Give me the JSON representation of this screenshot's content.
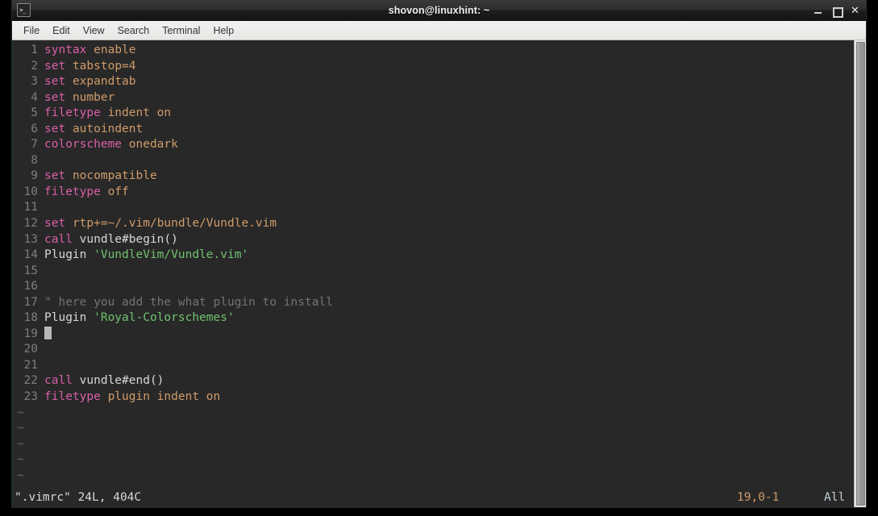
{
  "window": {
    "title": "shovon@linuxhint: ~",
    "icon": "terminal-icon",
    "controls": {
      "minimize": "–",
      "maximize": "□",
      "close": "✕"
    }
  },
  "menubar": {
    "items": [
      {
        "label": "File"
      },
      {
        "label": "Edit"
      },
      {
        "label": "View"
      },
      {
        "label": "Search"
      },
      {
        "label": "Terminal"
      },
      {
        "label": "Help"
      }
    ]
  },
  "editor": {
    "colors": {
      "background": "#282828",
      "keyword": "#d85fa8",
      "argument": "#cf9b6a",
      "identifier": "#d8d8d8",
      "string": "#71c171",
      "comment": "#6f7575",
      "line_number": "#7a7f7f",
      "tilde": "#5a6b6d",
      "cursor": "#b8b8b8"
    },
    "lines": [
      {
        "num": "1",
        "tokens": [
          {
            "t": "syntax",
            "c": "kw"
          },
          {
            "t": " ",
            "c": "id"
          },
          {
            "t": "enable",
            "c": "arg"
          }
        ]
      },
      {
        "num": "2",
        "tokens": [
          {
            "t": "set",
            "c": "kw"
          },
          {
            "t": " ",
            "c": "id"
          },
          {
            "t": "tabstop=4",
            "c": "arg"
          }
        ]
      },
      {
        "num": "3",
        "tokens": [
          {
            "t": "set",
            "c": "kw"
          },
          {
            "t": " ",
            "c": "id"
          },
          {
            "t": "expandtab",
            "c": "arg"
          }
        ]
      },
      {
        "num": "4",
        "tokens": [
          {
            "t": "set",
            "c": "kw"
          },
          {
            "t": " ",
            "c": "id"
          },
          {
            "t": "number",
            "c": "arg"
          }
        ]
      },
      {
        "num": "5",
        "tokens": [
          {
            "t": "filetype",
            "c": "kw"
          },
          {
            "t": " ",
            "c": "id"
          },
          {
            "t": "indent on",
            "c": "arg"
          }
        ]
      },
      {
        "num": "6",
        "tokens": [
          {
            "t": "set",
            "c": "kw"
          },
          {
            "t": " ",
            "c": "id"
          },
          {
            "t": "autoindent",
            "c": "arg"
          }
        ]
      },
      {
        "num": "7",
        "tokens": [
          {
            "t": "colorscheme",
            "c": "kw"
          },
          {
            "t": " ",
            "c": "id"
          },
          {
            "t": "onedark",
            "c": "arg"
          }
        ]
      },
      {
        "num": "8",
        "tokens": []
      },
      {
        "num": "9",
        "tokens": [
          {
            "t": "set",
            "c": "kw"
          },
          {
            "t": " ",
            "c": "id"
          },
          {
            "t": "nocompatible",
            "c": "arg"
          }
        ]
      },
      {
        "num": "10",
        "tokens": [
          {
            "t": "filetype",
            "c": "kw"
          },
          {
            "t": " ",
            "c": "id"
          },
          {
            "t": "off",
            "c": "arg"
          }
        ]
      },
      {
        "num": "11",
        "tokens": []
      },
      {
        "num": "12",
        "tokens": [
          {
            "t": "set",
            "c": "kw"
          },
          {
            "t": " ",
            "c": "id"
          },
          {
            "t": "rtp+=~/.vim/bundle/Vundle.vim",
            "c": "arg"
          }
        ]
      },
      {
        "num": "13",
        "tokens": [
          {
            "t": "call",
            "c": "kw"
          },
          {
            "t": " vundle#begin()",
            "c": "id"
          }
        ]
      },
      {
        "num": "14",
        "tokens": [
          {
            "t": "Plugin ",
            "c": "id"
          },
          {
            "t": "'VundleVim/Vundle.vim'",
            "c": "str"
          }
        ]
      },
      {
        "num": "15",
        "tokens": []
      },
      {
        "num": "16",
        "tokens": []
      },
      {
        "num": "17",
        "tokens": [
          {
            "t": "\" here you add the what plugin to install",
            "c": "cmt"
          }
        ]
      },
      {
        "num": "18",
        "tokens": [
          {
            "t": "Plugin ",
            "c": "id"
          },
          {
            "t": "'Royal-Colorschemes'",
            "c": "str"
          }
        ]
      },
      {
        "num": "19",
        "tokens": [
          {
            "t": "",
            "c": "cursor"
          }
        ]
      },
      {
        "num": "20",
        "tokens": []
      },
      {
        "num": "21",
        "tokens": []
      },
      {
        "num": "22",
        "tokens": [
          {
            "t": "call",
            "c": "kw"
          },
          {
            "t": " vundle#end()",
            "c": "id"
          }
        ]
      },
      {
        "num": "23",
        "tokens": [
          {
            "t": "filetype",
            "c": "kw"
          },
          {
            "t": " ",
            "c": "id"
          },
          {
            "t": "plugin indent on",
            "c": "arg"
          }
        ]
      }
    ],
    "empty_markers": [
      "~",
      "~",
      "~",
      "~",
      "~",
      "~",
      "~"
    ],
    "cursor_line": 19
  },
  "statusline": {
    "file_info": "\".vimrc\" 24L, 404C",
    "position": "19,0-1",
    "scroll_indicator": "All"
  },
  "scrollbar": {
    "orientation": "vertical",
    "thumb_position": "full"
  }
}
